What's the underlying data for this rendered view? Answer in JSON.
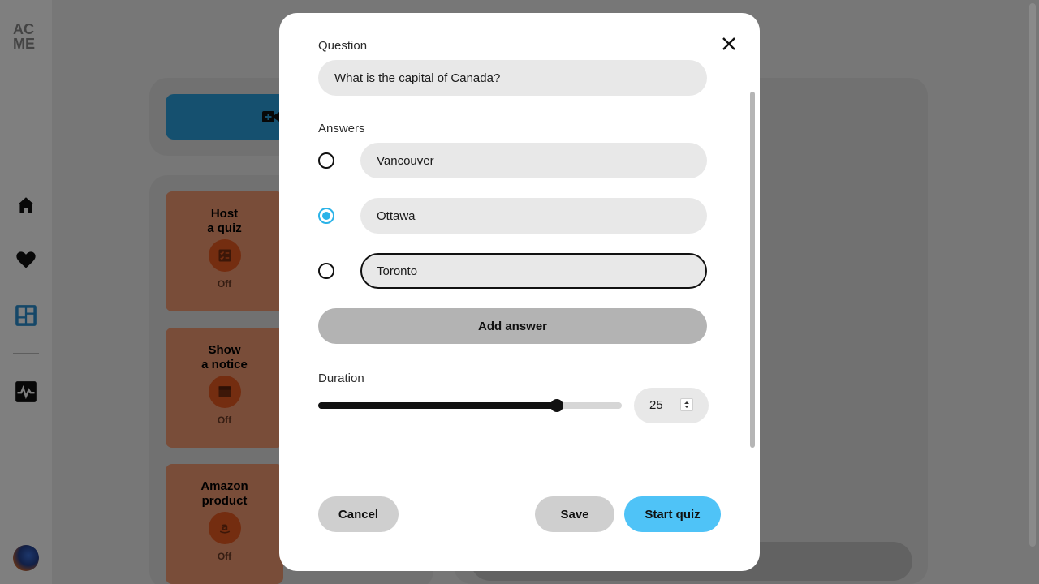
{
  "app": {
    "logo_text": "ACME",
    "nav_icons": [
      "home-icon",
      "heart-icon",
      "dashboard-icon",
      "activity-icon"
    ],
    "add_video_icon": "video-plus-icon",
    "cards": [
      {
        "title_line1": "Host",
        "title_line2": "a quiz",
        "icon": "quiz-icon",
        "state": "Off"
      },
      {
        "title_line1": "Show",
        "title_line2": "a notice",
        "icon": "notice-icon",
        "state": "Off"
      },
      {
        "title_line1": "Amazon",
        "title_line2": "product",
        "icon": "amazon-icon",
        "state": "Off"
      }
    ]
  },
  "modal": {
    "question_label": "Question",
    "question_value": "What is the capital of Canada?",
    "answers_label": "Answers",
    "answers": [
      {
        "text": "Vancouver",
        "selected": false
      },
      {
        "text": "Ottawa",
        "selected": true
      },
      {
        "text": "Toronto",
        "selected": false,
        "focused": true
      }
    ],
    "add_answer_label": "Add answer",
    "duration_label": "Duration",
    "duration_value": "25",
    "duration_slider_fraction": 0.785,
    "cancel_label": "Cancel",
    "save_label": "Save",
    "start_label": "Start quiz",
    "accent_color": "#2bb3e8"
  }
}
